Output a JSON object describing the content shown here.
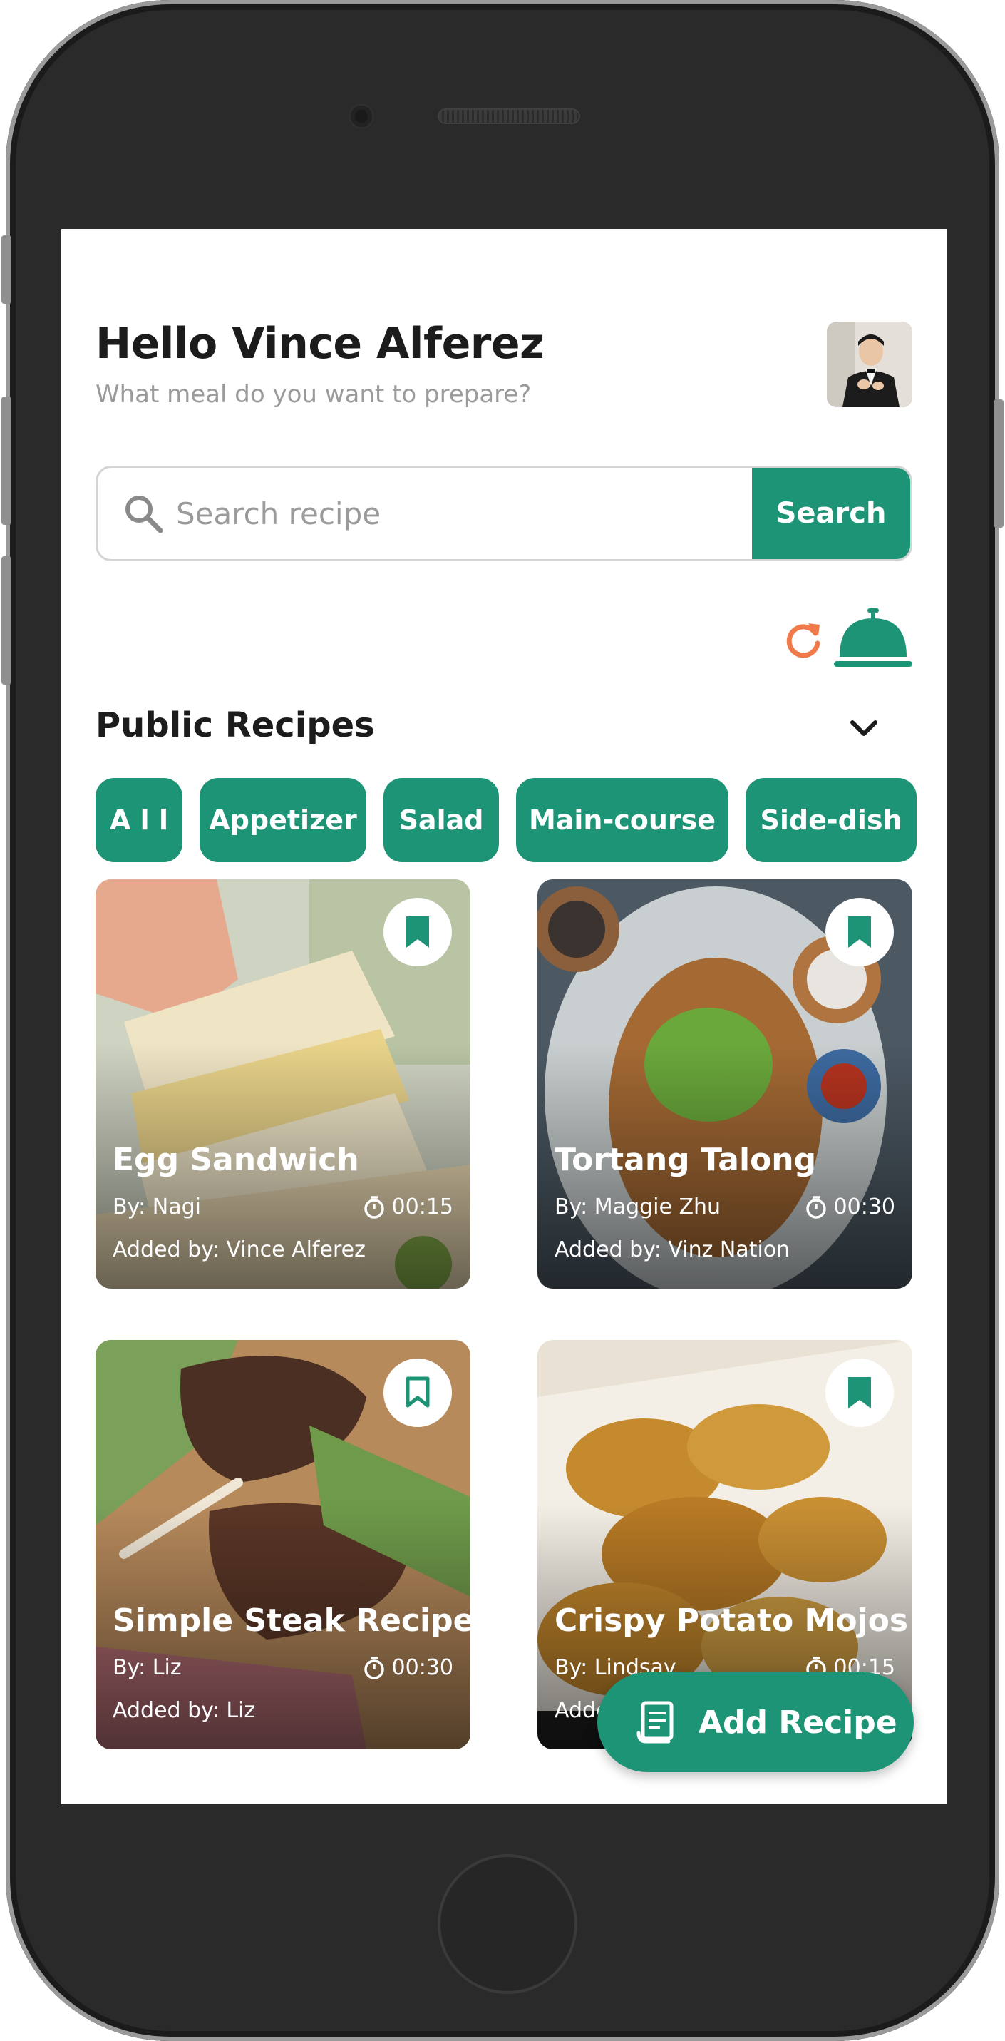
{
  "header": {
    "greeting": "Hello Vince Alferez",
    "subtitle": "What meal do you want to prepare?"
  },
  "search": {
    "placeholder": "Search recipe",
    "button_label": "Search"
  },
  "section": {
    "title": "Public Recipes"
  },
  "categories": [
    "A l l",
    "Appetizer",
    "Salad",
    "Main-course",
    "Side-dish"
  ],
  "recipes": [
    {
      "title": "Egg Sandwich",
      "author": "By: Nagi",
      "time": "00:15",
      "added_by": "Added by: Vince Alferez",
      "bookmarked": true
    },
    {
      "title": "Tortang Talong",
      "author": "By: Maggie Zhu",
      "time": "00:30",
      "added_by": "Added by: Vinz Nation",
      "bookmarked": true
    },
    {
      "title": "Simple Steak Recipe",
      "author": "By: Liz",
      "time": "00:30",
      "added_by": "Added by: Liz",
      "bookmarked": false
    },
    {
      "title": "Crispy Potato Mojos",
      "author": "By: Lindsay",
      "time": "00:15",
      "added_by": "Added by: Lindsay",
      "bookmarked": true
    }
  ],
  "fab": {
    "label": "Add Recipe"
  },
  "colors": {
    "accent": "#1e9476",
    "refresh": "#f07a4a",
    "muted_text": "#9b9b9b"
  }
}
